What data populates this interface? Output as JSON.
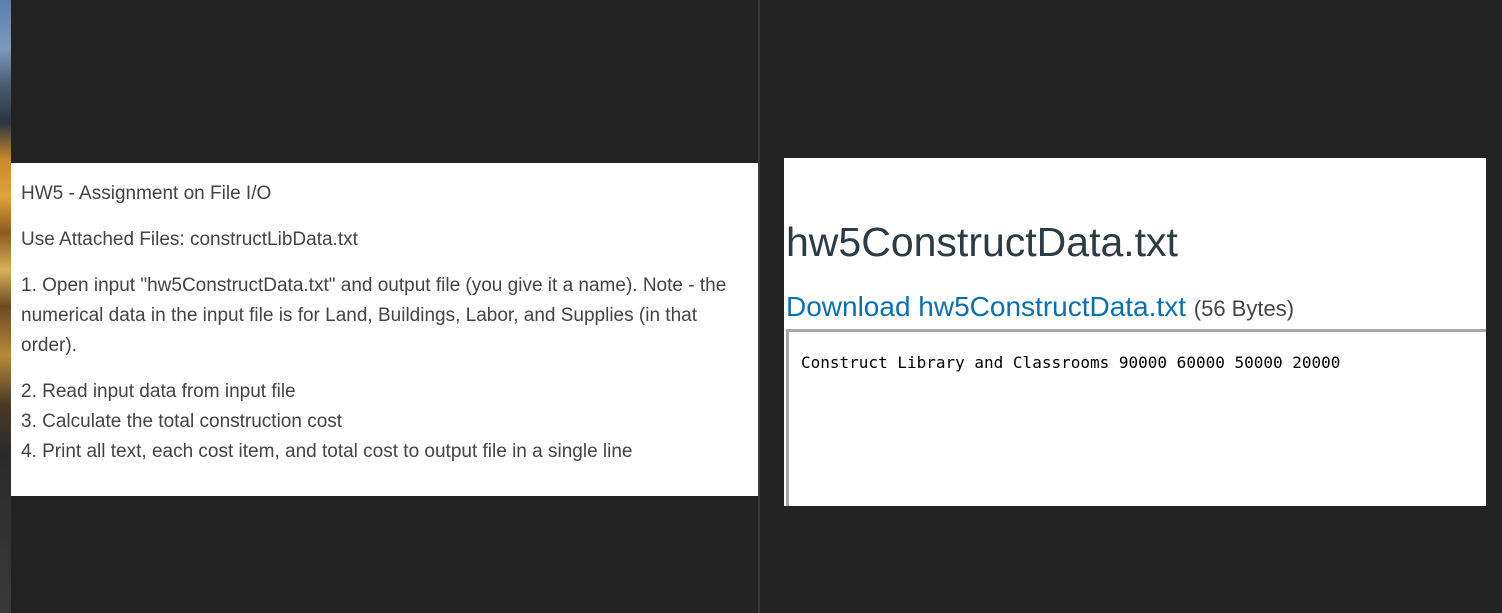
{
  "assignment": {
    "title": "HW5 - Assignment on File I/O",
    "attached": "Use Attached Files: constructLibData.txt",
    "step1": "1. Open input \"hw5ConstructData.txt\" and output file (you give it a name).  Note - the numerical data in the input file is for Land, Buildings, Labor, and Supplies (in that order).",
    "step2": "2. Read input data from input file",
    "step3": "3. Calculate the total construction cost",
    "step4": "4. Print all text, each cost item, and total cost to output file in a single line"
  },
  "file_viewer": {
    "filename": "hw5ConstructData.txt",
    "download_label": "Download hw5ConstructData.txt",
    "file_size": "(56 Bytes)",
    "content": "Construct Library and Classrooms 90000 60000 50000 20000"
  },
  "colors": {
    "background": "#222222",
    "link": "#0b6fb5",
    "title_text": "#2d3b45",
    "body_text": "#444444"
  }
}
